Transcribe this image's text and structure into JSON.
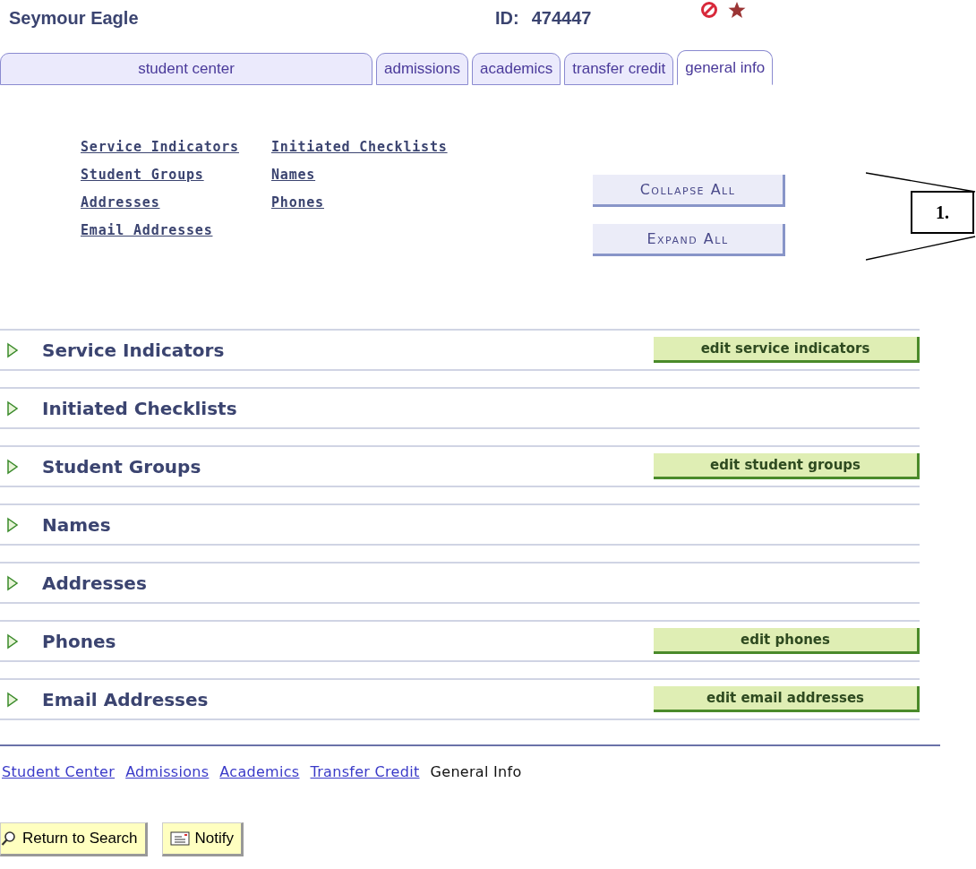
{
  "header": {
    "name": "Seymour Eagle",
    "id_label": "ID:",
    "id_value": "474447"
  },
  "tabs": [
    {
      "label": "student center",
      "selected": false
    },
    {
      "label": "admissions",
      "selected": false
    },
    {
      "label": "academics",
      "selected": false
    },
    {
      "label": "transfer credit",
      "selected": false
    },
    {
      "label": "general info",
      "selected": true
    }
  ],
  "quick_links": [
    {
      "label": "Service Indicators"
    },
    {
      "label": "Student Groups"
    },
    {
      "label": "Addresses"
    },
    {
      "label": "Email Addresses"
    },
    {
      "label": "Initiated Checklists"
    },
    {
      "label": "Names"
    },
    {
      "label": "Phones"
    }
  ],
  "collapse_button": "Collapse All",
  "expand_button": "Expand All",
  "callout": "1.",
  "sections": [
    {
      "title": "Service Indicators",
      "expanded": false,
      "edit_button": "edit service indicators"
    },
    {
      "title": "Initiated Checklists",
      "expanded": false
    },
    {
      "title": "Student Groups",
      "expanded": false,
      "edit_button": "edit student groups"
    },
    {
      "title": "Names",
      "expanded": false
    },
    {
      "title": "Addresses",
      "expanded": false
    },
    {
      "title": "Phones",
      "expanded": false,
      "edit_button": "edit phones"
    },
    {
      "title": "Email Addresses",
      "expanded": false,
      "edit_button": "edit email addresses"
    }
  ],
  "footer_links": [
    {
      "label": "Student Center",
      "selected": false
    },
    {
      "label": "Admissions",
      "selected": false
    },
    {
      "label": "Academics",
      "selected": false
    },
    {
      "label": "Transfer Credit",
      "selected": false
    },
    {
      "label": "General Info",
      "selected": true
    }
  ],
  "bottom_buttons": [
    {
      "kind": "search",
      "label": "Return to Search"
    },
    {
      "kind": "notify",
      "label": "Notify"
    }
  ]
}
